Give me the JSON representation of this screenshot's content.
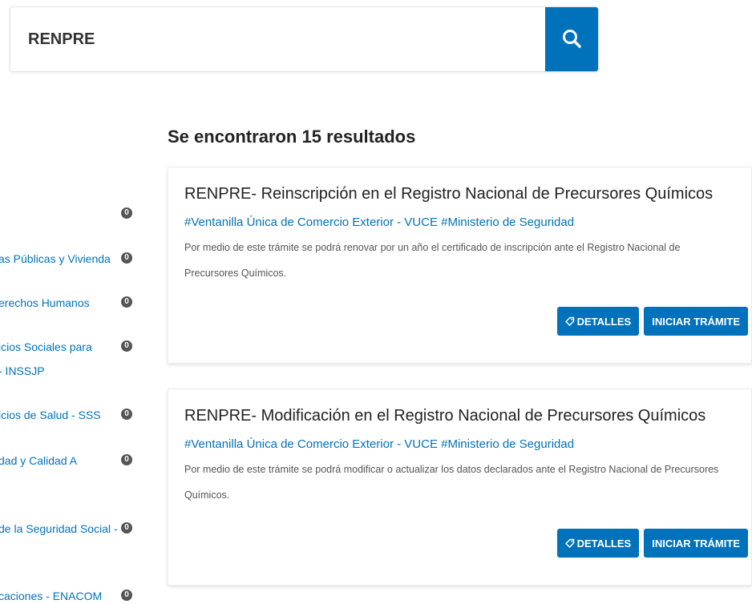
{
  "search": {
    "value": "RENPRE"
  },
  "results": {
    "title": "Se encontraron 15 resultados"
  },
  "sidebar": {
    "items": [
      {
        "label": "",
        "count": "0"
      },
      {
        "label": "as Públicas y Vivienda",
        "count": "0"
      },
      {
        "label": "erechos Humanos",
        "count": "0"
      },
      {
        "label": "icios Sociales para - INSSJP",
        "count": "0"
      },
      {
        "label": "icios de Salud - SSS",
        "count": "0"
      },
      {
        "label": "dad y Calidad A",
        "count": "0"
      },
      {
        "label": "de la Seguridad Social -",
        "count": "0"
      },
      {
        "label": "caciones - ENACOM",
        "count": "0"
      }
    ]
  },
  "cards": [
    {
      "title": "RENPRE- Reinscripción en el Registro Nacional de Precursores Químicos",
      "tags": "#Ventanilla Única de Comercio Exterior - VUCE #Ministerio de Seguridad",
      "description": "Por medio de este trámite se podrá renovar por un año el certificado de inscripción ante el Registro Nacional de Precursores Químicos.",
      "details_label": "DETALLES",
      "start_label": "INICIAR TRÁMITE"
    },
    {
      "title": "RENPRE- Modificación en el Registro Nacional de Precursores Químicos",
      "tags": "#Ventanilla Única de Comercio Exterior - VUCE #Ministerio de Seguridad",
      "description": "Por medio de este trámite se podrá modificar o actualizar los datos declarados ante el Registro Nacional de Precursores Químicos.",
      "details_label": "DETALLES",
      "start_label": "INICIAR TRÁMITE"
    }
  ],
  "colors": {
    "primary": "#0072bb",
    "badge": "#555555"
  },
  "icons": {
    "search": "search-icon",
    "details": "tag-icon"
  }
}
